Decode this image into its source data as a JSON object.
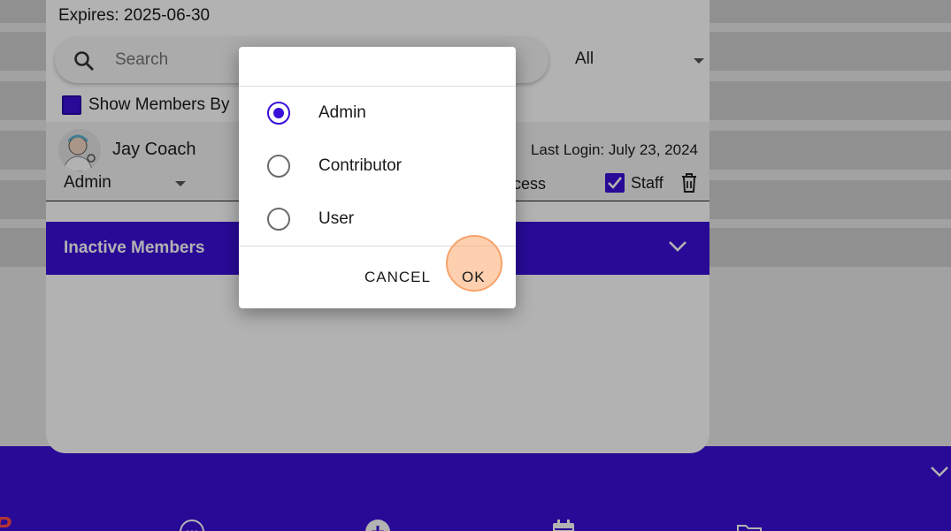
{
  "panel": {
    "expires": "Expires: 2025-06-30",
    "search_placeholder": "Search",
    "filter_value": "All",
    "show_members_label": "Show Members By",
    "member": {
      "name": "Jay Coach",
      "last_login": "Last Login: July 23, 2024",
      "role": "Admin",
      "access_label": "cess",
      "staff_label": "Staff"
    },
    "inactive_label": "Inactive Members"
  },
  "dialog": {
    "options": [
      {
        "label": "Admin",
        "selected": true
      },
      {
        "label": "Contributor",
        "selected": false
      },
      {
        "label": "User",
        "selected": false
      }
    ],
    "cancel_label": "CANCEL",
    "ok_label": "OK"
  },
  "colors": {
    "accent": "#3a0fd8",
    "tap_highlight": "#f6a36a"
  },
  "bottom_nav": {
    "icons": [
      "chat-icon",
      "add-circle-icon",
      "calendar-icon",
      "folder-icon"
    ]
  }
}
